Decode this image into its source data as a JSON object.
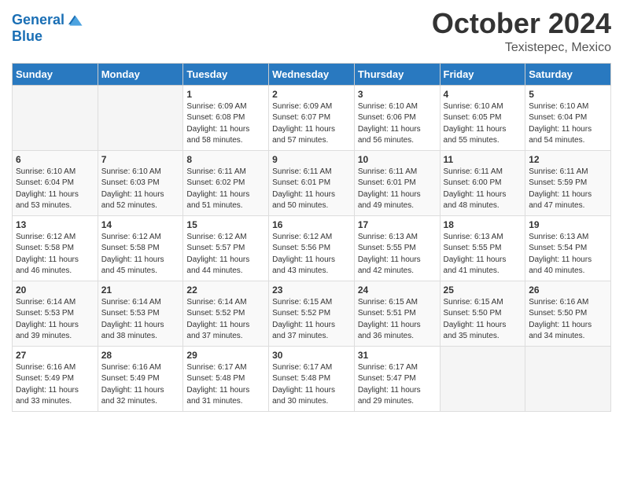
{
  "header": {
    "logo_line1": "General",
    "logo_line2": "Blue",
    "month": "October 2024",
    "location": "Texistepec, Mexico"
  },
  "days_of_week": [
    "Sunday",
    "Monday",
    "Tuesday",
    "Wednesday",
    "Thursday",
    "Friday",
    "Saturday"
  ],
  "weeks": [
    [
      {
        "day": "",
        "info": ""
      },
      {
        "day": "",
        "info": ""
      },
      {
        "day": "1",
        "info": "Sunrise: 6:09 AM\nSunset: 6:08 PM\nDaylight: 11 hours\nand 58 minutes."
      },
      {
        "day": "2",
        "info": "Sunrise: 6:09 AM\nSunset: 6:07 PM\nDaylight: 11 hours\nand 57 minutes."
      },
      {
        "day": "3",
        "info": "Sunrise: 6:10 AM\nSunset: 6:06 PM\nDaylight: 11 hours\nand 56 minutes."
      },
      {
        "day": "4",
        "info": "Sunrise: 6:10 AM\nSunset: 6:05 PM\nDaylight: 11 hours\nand 55 minutes."
      },
      {
        "day": "5",
        "info": "Sunrise: 6:10 AM\nSunset: 6:04 PM\nDaylight: 11 hours\nand 54 minutes."
      }
    ],
    [
      {
        "day": "6",
        "info": "Sunrise: 6:10 AM\nSunset: 6:04 PM\nDaylight: 11 hours\nand 53 minutes."
      },
      {
        "day": "7",
        "info": "Sunrise: 6:10 AM\nSunset: 6:03 PM\nDaylight: 11 hours\nand 52 minutes."
      },
      {
        "day": "8",
        "info": "Sunrise: 6:11 AM\nSunset: 6:02 PM\nDaylight: 11 hours\nand 51 minutes."
      },
      {
        "day": "9",
        "info": "Sunrise: 6:11 AM\nSunset: 6:01 PM\nDaylight: 11 hours\nand 50 minutes."
      },
      {
        "day": "10",
        "info": "Sunrise: 6:11 AM\nSunset: 6:01 PM\nDaylight: 11 hours\nand 49 minutes."
      },
      {
        "day": "11",
        "info": "Sunrise: 6:11 AM\nSunset: 6:00 PM\nDaylight: 11 hours\nand 48 minutes."
      },
      {
        "day": "12",
        "info": "Sunrise: 6:11 AM\nSunset: 5:59 PM\nDaylight: 11 hours\nand 47 minutes."
      }
    ],
    [
      {
        "day": "13",
        "info": "Sunrise: 6:12 AM\nSunset: 5:58 PM\nDaylight: 11 hours\nand 46 minutes."
      },
      {
        "day": "14",
        "info": "Sunrise: 6:12 AM\nSunset: 5:58 PM\nDaylight: 11 hours\nand 45 minutes."
      },
      {
        "day": "15",
        "info": "Sunrise: 6:12 AM\nSunset: 5:57 PM\nDaylight: 11 hours\nand 44 minutes."
      },
      {
        "day": "16",
        "info": "Sunrise: 6:12 AM\nSunset: 5:56 PM\nDaylight: 11 hours\nand 43 minutes."
      },
      {
        "day": "17",
        "info": "Sunrise: 6:13 AM\nSunset: 5:55 PM\nDaylight: 11 hours\nand 42 minutes."
      },
      {
        "day": "18",
        "info": "Sunrise: 6:13 AM\nSunset: 5:55 PM\nDaylight: 11 hours\nand 41 minutes."
      },
      {
        "day": "19",
        "info": "Sunrise: 6:13 AM\nSunset: 5:54 PM\nDaylight: 11 hours\nand 40 minutes."
      }
    ],
    [
      {
        "day": "20",
        "info": "Sunrise: 6:14 AM\nSunset: 5:53 PM\nDaylight: 11 hours\nand 39 minutes."
      },
      {
        "day": "21",
        "info": "Sunrise: 6:14 AM\nSunset: 5:53 PM\nDaylight: 11 hours\nand 38 minutes."
      },
      {
        "day": "22",
        "info": "Sunrise: 6:14 AM\nSunset: 5:52 PM\nDaylight: 11 hours\nand 37 minutes."
      },
      {
        "day": "23",
        "info": "Sunrise: 6:15 AM\nSunset: 5:52 PM\nDaylight: 11 hours\nand 37 minutes."
      },
      {
        "day": "24",
        "info": "Sunrise: 6:15 AM\nSunset: 5:51 PM\nDaylight: 11 hours\nand 36 minutes."
      },
      {
        "day": "25",
        "info": "Sunrise: 6:15 AM\nSunset: 5:50 PM\nDaylight: 11 hours\nand 35 minutes."
      },
      {
        "day": "26",
        "info": "Sunrise: 6:16 AM\nSunset: 5:50 PM\nDaylight: 11 hours\nand 34 minutes."
      }
    ],
    [
      {
        "day": "27",
        "info": "Sunrise: 6:16 AM\nSunset: 5:49 PM\nDaylight: 11 hours\nand 33 minutes."
      },
      {
        "day": "28",
        "info": "Sunrise: 6:16 AM\nSunset: 5:49 PM\nDaylight: 11 hours\nand 32 minutes."
      },
      {
        "day": "29",
        "info": "Sunrise: 6:17 AM\nSunset: 5:48 PM\nDaylight: 11 hours\nand 31 minutes."
      },
      {
        "day": "30",
        "info": "Sunrise: 6:17 AM\nSunset: 5:48 PM\nDaylight: 11 hours\nand 30 minutes."
      },
      {
        "day": "31",
        "info": "Sunrise: 6:17 AM\nSunset: 5:47 PM\nDaylight: 11 hours\nand 29 minutes."
      },
      {
        "day": "",
        "info": ""
      },
      {
        "day": "",
        "info": ""
      }
    ]
  ]
}
